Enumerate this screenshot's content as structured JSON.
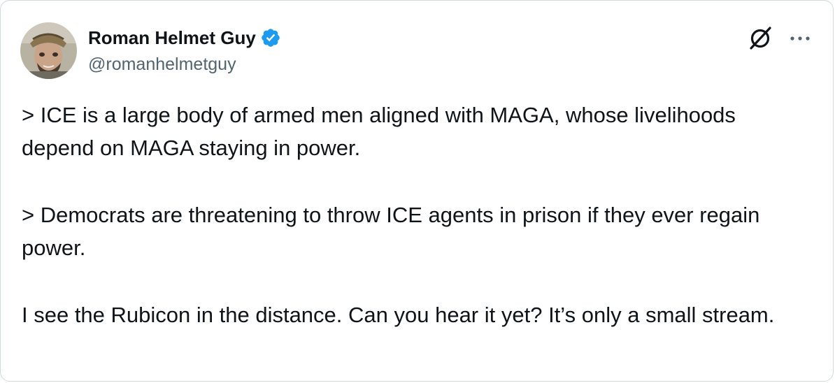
{
  "tweet": {
    "author": {
      "display_name": "Roman Helmet Guy",
      "handle": "@romanhelmetguy",
      "verified": true,
      "verified_color": "#1d9bf0"
    },
    "paragraphs": [
      "> ICE is a large body of armed men aligned with MAGA, whose livelihoods depend on MAGA staying in power.",
      "> Democrats are threatening to throw ICE agents in prison if they ever regain power.",
      "I see the Rubicon in the distance. Can you hear it yet? It’s only a small stream."
    ],
    "icons": {
      "avatar": "avatar-photo",
      "verified": "verified-badge-icon",
      "grok": "grok-icon",
      "more": "more-options-icon"
    }
  },
  "colors": {
    "text_primary": "#0f1419",
    "text_secondary": "#536471",
    "border": "#cfd9de"
  }
}
